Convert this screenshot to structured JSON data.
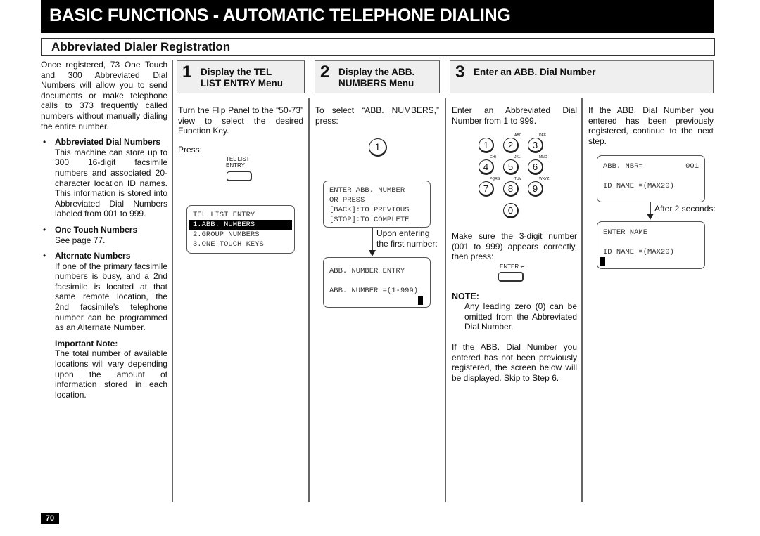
{
  "header": {
    "title": "BASIC FUNCTIONS - AUTOMATIC TELEPHONE DIALING",
    "section": "Abbreviated Dialer Registration"
  },
  "intro": {
    "text": "Once registered, 73 One Touch and 300 Abbreviated Dial Numbers will allow you to send documents or make telephone calls to 373 frequently called numbers without manually dialing the entire number.",
    "bullets": [
      {
        "title": "Abbreviated Dial Numbers",
        "text": "This machine can store up to 300 16-digit facsimile numbers and associated 20-character location ID names. This information is stored into Abbreviated Dial Numbers labeled from 001 to 999."
      },
      {
        "title": "One Touch Numbers",
        "text": "See page 77."
      },
      {
        "title": "Alternate Numbers",
        "text": "If one of the primary facsimile numbers is busy, and a 2nd facsimile is located at that same remote location, the 2nd facsimile’s telephone number can be programmed as an Alternate Number."
      }
    ],
    "important_note": {
      "title": "Important Note:",
      "text": "The total number of available locations will vary depending upon the amount of information stored in each location."
    }
  },
  "steps": [
    {
      "number": "1",
      "title_line1": "Display the TEL",
      "title_line2": "LIST ENTRY Menu",
      "text": "Turn the Flip Panel to the “50-73” view to select the desired Function Key.",
      "press_label": "Press:",
      "key_label_line1": "TEL LIST",
      "key_label_line2": "ENTRY",
      "lcd": [
        "TEL LIST ENTRY",
        "1.ABB. NUMBERS",
        "2.GROUP NUMBERS",
        "3.ONE TOUCH KEYS"
      ]
    },
    {
      "number": "2",
      "title_line1": "Display the ABB.",
      "title_line2": "NUMBERS Menu",
      "text": "To select “ABB. NUMBERS,” press:",
      "key": "1",
      "lcd1": [
        "ENTER ABB. NUMBER",
        "OR PRESS",
        "[BACK]:TO PREVIOUS",
        "[STOP]:TO COMPLETE"
      ],
      "transition_line1": "Upon entering",
      "transition_line2": "the first number:",
      "lcd2": [
        "ABB. NUMBER ENTRY",
        "",
        "ABB. NUMBER =(1-999)"
      ]
    },
    {
      "number": "3",
      "title_line1": "Enter an ABB. Dial Number",
      "text": "Enter an Abbreviated Dial Number from 1 to 999.",
      "keypad": [
        {
          "digit": "1",
          "letters": ""
        },
        {
          "digit": "2",
          "letters": "ABC"
        },
        {
          "digit": "3",
          "letters": "DEF"
        },
        {
          "digit": "4",
          "letters": "GHI"
        },
        {
          "digit": "5",
          "letters": "JKL"
        },
        {
          "digit": "6",
          "letters": "MNO"
        },
        {
          "digit": "7",
          "letters": "PQRS"
        },
        {
          "digit": "8",
          "letters": "TUV"
        },
        {
          "digit": "9",
          "letters": "WXYZ"
        },
        {
          "digit": "0",
          "letters": ""
        }
      ],
      "confirm_text": "Make sure the 3-digit number (001 to 999) appears correctly, then press:",
      "enter_key_label": "ENTER",
      "note_title": "NOTE:",
      "note_text": "Any leading zero (0) can be omitted from the Abbreviated Dial Number.",
      "not_registered_text": "If the ABB. Dial Number you entered has not been previously registered, the screen below will be displayed. Skip to Step 6.",
      "registered_text": "If the ABB. Dial Number you entered has been previously registered, continue to the next step.",
      "lcd1": {
        "line1_left": "ABB. NBR=",
        "line1_right": "001",
        "line3": "ID NAME =(MAX20)"
      },
      "transition": "After 2 seconds:",
      "lcd2": [
        "ENTER NAME",
        "",
        "ID NAME =(MAX20)"
      ]
    }
  ],
  "footer": {
    "page_number": "70"
  }
}
